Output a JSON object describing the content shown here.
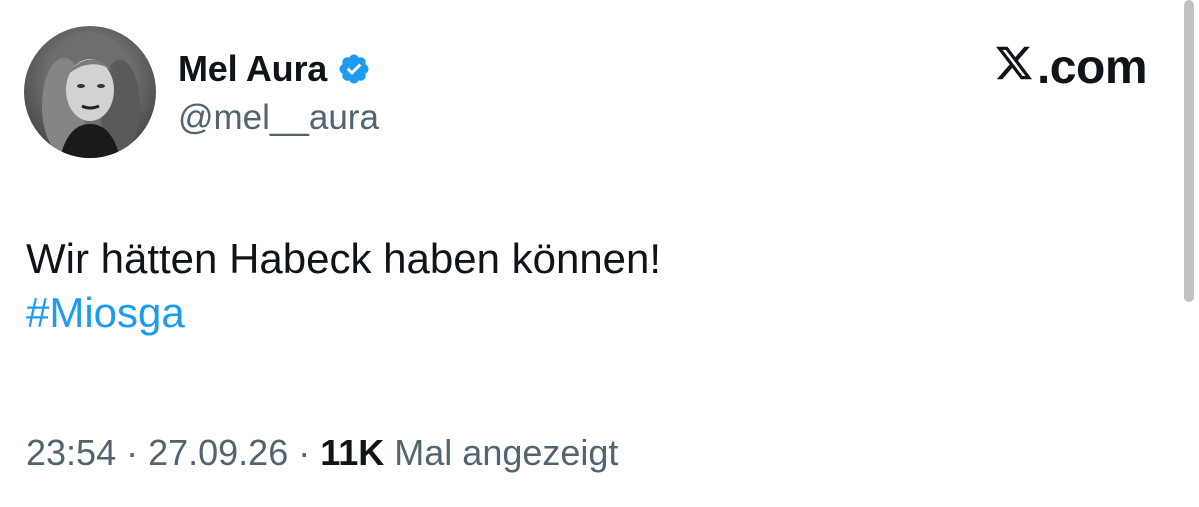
{
  "author": {
    "display_name": "Mel Aura",
    "handle": "@mel__aura",
    "verified": true,
    "avatar_icon": "profile-photo"
  },
  "brand": {
    "label": ".com",
    "logo_icon": "x-logo-icon"
  },
  "tweet": {
    "text": "Wir hätten Habeck haben können!",
    "hashtag": "#Miosga"
  },
  "meta": {
    "time": "23:54",
    "separator1": " · ",
    "date": "27.09.26",
    "separator2": " · ",
    "views_count": "11K",
    "views_label": " Mal angezeigt"
  },
  "colors": {
    "link": "#1d9bf0",
    "verified": "#1d9bf0",
    "secondary_text": "#536471",
    "primary_text": "#0f1419"
  }
}
